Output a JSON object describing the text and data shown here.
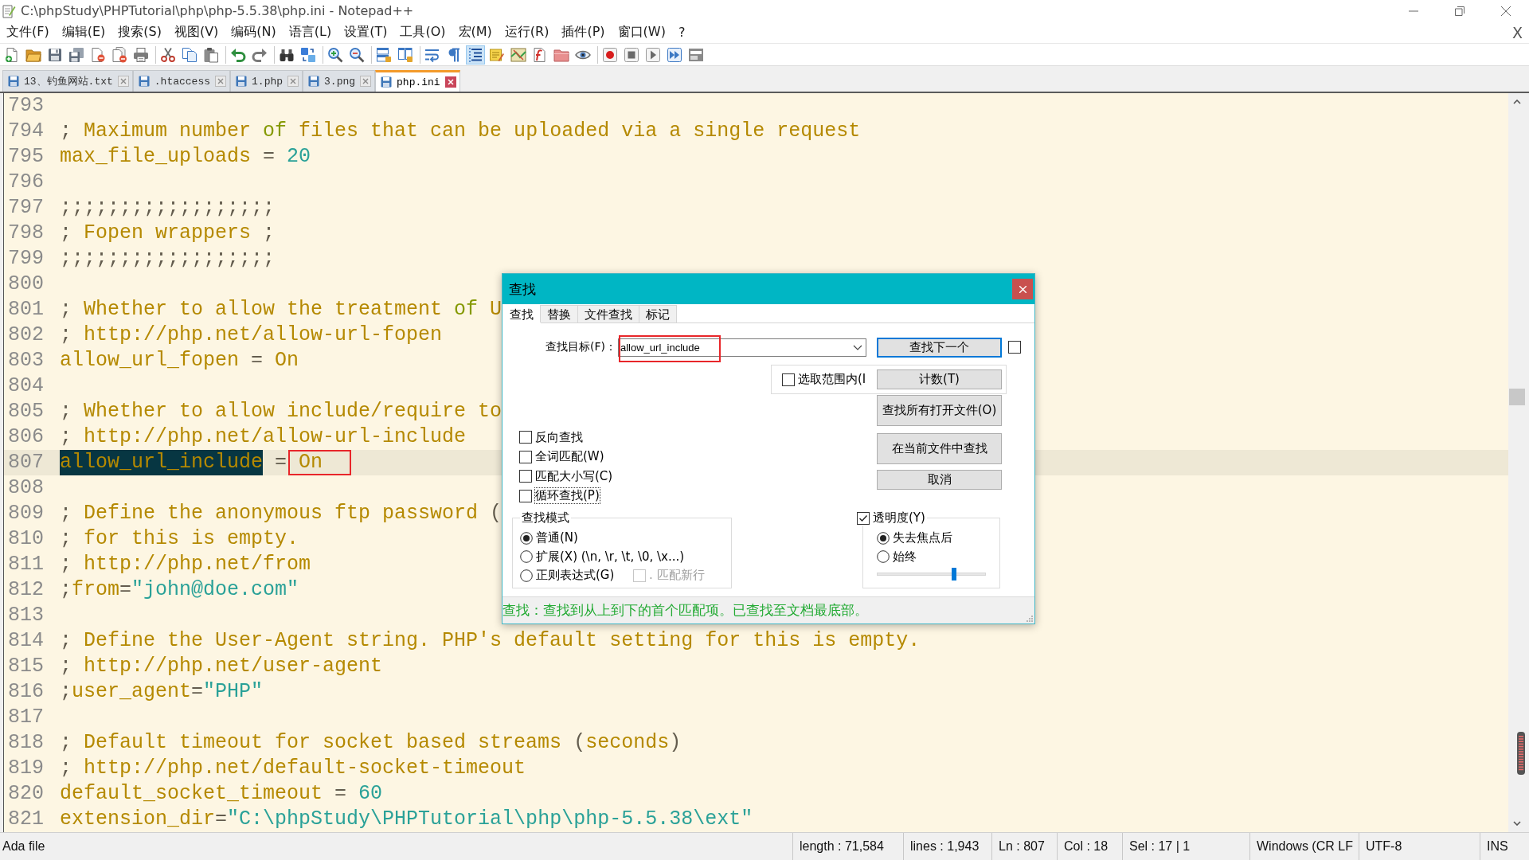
{
  "window": {
    "title": "C:\\phpStudy\\PHPTutorial\\php\\php-5.5.38\\php.ini - Notepad++"
  },
  "menu": {
    "items": [
      "文件(F)",
      "编辑(E)",
      "搜索(S)",
      "视图(V)",
      "编码(N)",
      "语言(L)",
      "设置(T)",
      "工具(O)",
      "宏(M)",
      "运行(R)",
      "插件(P)",
      "窗口(W)",
      "?"
    ],
    "close": "X"
  },
  "toolbar": [
    [
      {
        "pressed": false
      },
      {
        "pressed": false
      },
      {
        "pressed": false
      },
      {
        "pressed": false
      },
      {
        "pressed": false
      },
      {
        "pressed": false
      },
      {
        "pressed": false
      }
    ],
    [
      {
        "pressed": false
      },
      {
        "pressed": false
      },
      {
        "pressed": false
      }
    ],
    [
      {
        "pressed": false
      },
      {
        "pressed": false
      }
    ],
    [
      {
        "pressed": false
      },
      {
        "pressed": false
      }
    ],
    [
      {
        "pressed": false
      },
      {
        "pressed": false
      }
    ],
    [
      {
        "pressed": false
      },
      {
        "pressed": false
      }
    ],
    [
      {
        "pressed": false
      },
      {
        "pressed": false
      },
      {
        "pressed": true
      },
      {
        "pressed": false
      },
      {
        "pressed": false
      },
      {
        "pressed": false
      },
      {
        "pressed": false
      },
      {
        "pressed": false
      }
    ],
    [
      {
        "pressed": false
      },
      {
        "pressed": false
      },
      {
        "pressed": false
      },
      {
        "pressed": false
      },
      {
        "pressed": false
      }
    ]
  ],
  "tabs": [
    {
      "label": "13、钓鱼网站.txt",
      "selected": false
    },
    {
      "label": ".htaccess",
      "selected": false
    },
    {
      "label": "1.php",
      "selected": false
    },
    {
      "label": "3.png",
      "selected": false
    },
    {
      "label": "php.ini",
      "selected": true
    }
  ],
  "editor": {
    "lines": [
      {
        "number": "793",
        "current": false
      },
      {
        "number": "794",
        "current": false,
        "segments": [
          {
            "text": ";",
            "kind": "punct"
          },
          {
            "text": " Maximum number ",
            "kind": "text"
          },
          {
            "text": "of",
            "kind": "keyword"
          },
          {
            "text": " files that can be uploaded via a single request",
            "kind": "text"
          }
        ]
      },
      {
        "number": "795",
        "current": false,
        "segments": [
          {
            "text": "max_file_uploads ",
            "kind": "text"
          },
          {
            "text": "= ",
            "kind": "punct"
          },
          {
            "text": "20",
            "kind": "number"
          }
        ]
      },
      {
        "number": "796",
        "current": false
      },
      {
        "number": "797",
        "current": false,
        "segments": [
          {
            "text": ";;;;;;;;;;;;;;;;;;",
            "kind": "punct"
          }
        ]
      },
      {
        "number": "798",
        "current": false,
        "segments": [
          {
            "text": ";",
            "kind": "punct"
          },
          {
            "text": " Fopen wrappers ",
            "kind": "text"
          },
          {
            "text": ";",
            "kind": "punct"
          }
        ]
      },
      {
        "number": "799",
        "current": false,
        "segments": [
          {
            "text": ";;;;;;;;;;;;;;;;;;",
            "kind": "punct"
          }
        ]
      },
      {
        "number": "800",
        "current": false
      },
      {
        "number": "801",
        "current": false,
        "segments": [
          {
            "text": ";",
            "kind": "punct"
          },
          {
            "text": " Whether to allow the treatment ",
            "kind": "text"
          },
          {
            "text": "of",
            "kind": "keyword"
          },
          {
            "text": " U",
            "kind": "text"
          }
        ]
      },
      {
        "number": "802",
        "current": false,
        "segments": [
          {
            "text": ";",
            "kind": "punct"
          },
          {
            "text": " http://php.net/allow-url-fopen",
            "kind": "text"
          }
        ]
      },
      {
        "number": "803",
        "current": false,
        "segments": [
          {
            "text": "allow_url_fopen ",
            "kind": "text"
          },
          {
            "text": "= ",
            "kind": "punct"
          },
          {
            "text": "On",
            "kind": "text"
          }
        ]
      },
      {
        "number": "804",
        "current": false
      },
      {
        "number": "805",
        "current": false,
        "segments": [
          {
            "text": ";",
            "kind": "punct"
          },
          {
            "text": " Whether to allow include/require to",
            "kind": "text"
          }
        ]
      },
      {
        "number": "806",
        "current": false,
        "segments": [
          {
            "text": ";",
            "kind": "punct"
          },
          {
            "text": " http://php.net/allow-url-include",
            "kind": "text"
          }
        ]
      },
      {
        "number": "807",
        "current": true,
        "segments": [
          {
            "text": "allow_url_include",
            "kind": "text",
            "selected": true
          },
          {
            "text": " = ",
            "kind": "punct"
          },
          {
            "text": "On",
            "kind": "text",
            "annotated": true
          }
        ]
      },
      {
        "number": "808",
        "current": false
      },
      {
        "number": "809",
        "current": false,
        "segments": [
          {
            "text": ";",
            "kind": "punct"
          },
          {
            "text": " Define the anonymous ftp password ",
            "kind": "text"
          },
          {
            "text": "(",
            "kind": "punct"
          }
        ]
      },
      {
        "number": "810",
        "current": false,
        "segments": [
          {
            "text": ";",
            "kind": "punct"
          },
          {
            "text": " for this is empty.",
            "kind": "text"
          }
        ]
      },
      {
        "number": "811",
        "current": false,
        "segments": [
          {
            "text": ";",
            "kind": "punct"
          },
          {
            "text": " http://php.net/from",
            "kind": "text"
          }
        ]
      },
      {
        "number": "812",
        "current": false,
        "segments": [
          {
            "text": ";",
            "kind": "punct"
          },
          {
            "text": "from",
            "kind": "text"
          },
          {
            "text": "=",
            "kind": "punct"
          },
          {
            "text": "\"john@doe.com\"",
            "kind": "string"
          }
        ]
      },
      {
        "number": "813",
        "current": false
      },
      {
        "number": "814",
        "current": false,
        "segments": [
          {
            "text": ";",
            "kind": "punct"
          },
          {
            "text": " Define the User-Agent string. PHP's default setting for this is empty.",
            "kind": "text"
          }
        ]
      },
      {
        "number": "815",
        "current": false,
        "segments": [
          {
            "text": ";",
            "kind": "punct"
          },
          {
            "text": " http://php.net/user-agent",
            "kind": "text"
          }
        ]
      },
      {
        "number": "816",
        "current": false,
        "segments": [
          {
            "text": ";",
            "kind": "punct"
          },
          {
            "text": "user_agent",
            "kind": "text"
          },
          {
            "text": "=",
            "kind": "punct"
          },
          {
            "text": "\"PHP\"",
            "kind": "string"
          }
        ]
      },
      {
        "number": "817",
        "current": false
      },
      {
        "number": "818",
        "current": false,
        "segments": [
          {
            "text": ";",
            "kind": "punct"
          },
          {
            "text": " Default timeout for socket based streams ",
            "kind": "text"
          },
          {
            "text": "(",
            "kind": "punct"
          },
          {
            "text": "seconds",
            "kind": "text"
          },
          {
            "text": ")",
            "kind": "punct"
          }
        ]
      },
      {
        "number": "819",
        "current": false,
        "segments": [
          {
            "text": ";",
            "kind": "punct"
          },
          {
            "text": " http://php.net/default-socket-timeout",
            "kind": "text"
          }
        ]
      },
      {
        "number": "820",
        "current": false,
        "segments": [
          {
            "text": "default_socket_timeout ",
            "kind": "text"
          },
          {
            "text": "= ",
            "kind": "punct"
          },
          {
            "text": "60",
            "kind": "number"
          }
        ]
      },
      {
        "number": "821",
        "current": false,
        "segments": [
          {
            "text": "extension_dir",
            "kind": "text"
          },
          {
            "text": "=",
            "kind": "punct"
          },
          {
            "text": "\"C:\\phpStudy\\PHPTutorial\\php\\php-5.5.38\\ext\"",
            "kind": "string"
          }
        ]
      }
    ]
  },
  "find_dialog": {
    "title": "查找",
    "tabs": [
      {
        "label": "查找",
        "selected": true
      },
      {
        "label": "替换",
        "selected": false
      },
      {
        "label": "文件查找",
        "selected": false
      },
      {
        "label": "标记",
        "selected": false
      }
    ],
    "search_label": "查找目标(F)：",
    "search_field": {
      "value": "allow_url_include",
      "annotated": true
    },
    "buttons": [
      {
        "label": "查找下一个",
        "default": true
      },
      {
        "label": "计数(T)",
        "default": false
      },
      {
        "label": "查找所有打开文件(O)",
        "default": false
      },
      {
        "label": "在当前文件中查找",
        "default": false
      },
      {
        "label": "取消",
        "default": false
      }
    ],
    "side_checkbox": {
      "checked": false
    },
    "in_selection": {
      "label": "选取范围内(I",
      "checked": false
    },
    "options": [
      {
        "label": "反向查找",
        "checked": false,
        "focused": false
      },
      {
        "label": "全词匹配(W)",
        "checked": false,
        "focused": false
      },
      {
        "label": "匹配大小写(C)",
        "checked": false,
        "focused": false
      },
      {
        "label": "循环查找(P)",
        "checked": false,
        "focused": true
      }
    ],
    "search_mode": {
      "title": "查找模式",
      "modes": [
        {
          "label": "普通(N)",
          "selected": true
        },
        {
          "label": "扩展(X) (\\n, \\r, \\t, \\0, \\x...)",
          "selected": false
        },
        {
          "label": "正则表达式(G)",
          "selected": false
        }
      ],
      "dot_newline": {
        "label": ". 匹配新行",
        "checked": false,
        "disabled": true
      }
    },
    "transparency": {
      "label": "透明度(Y)",
      "checked": true,
      "modes": [
        {
          "label": "失去焦点后",
          "selected": true
        },
        {
          "label": "始终",
          "selected": false
        }
      ],
      "level": 0.71
    },
    "status": "查找：查找到从上到下的首个匹配项。已查找至文档最底部。"
  },
  "status_bar": [
    "Ada file",
    "length : 71,584",
    "lines : 1,943",
    "Ln : 807",
    "Col : 18",
    "Sel : 17 | 1",
    "Windows (CR LF",
    "UTF-8",
    "INS"
  ]
}
